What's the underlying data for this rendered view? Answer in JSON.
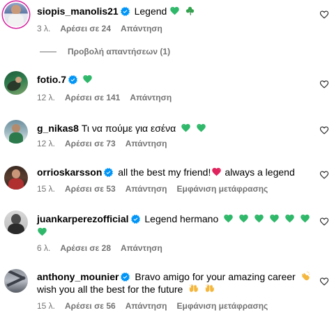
{
  "comments": [
    {
      "username": "siopis_manolis21",
      "verified": true,
      "text": "Legend",
      "time": "3 λ.",
      "likes": "Αρέσει σε 24",
      "reply": "Απάντηση",
      "view_replies": "Προβολή απαντήσεων (1)"
    },
    {
      "username": "fotio.7",
      "verified": true,
      "text": "",
      "time": "12 λ.",
      "likes": "Αρέσει σε 141",
      "reply": "Απάντηση"
    },
    {
      "username": "g_nikas8",
      "verified": false,
      "text": "Τι να πούμε για εσένα",
      "time": "12 λ.",
      "likes": "Αρέσει σε 73",
      "reply": "Απάντηση"
    },
    {
      "username": "orrioskarsson",
      "verified": true,
      "text": "all the best my friend!",
      "text2": "always a legend",
      "time": "15 λ.",
      "likes": "Αρέσει σε 53",
      "reply": "Απάντηση",
      "translate": "Εμφάνιση μετάφρασης"
    },
    {
      "username": "juankarperezofficial",
      "verified": true,
      "text": "Legend hermano",
      "time": "6 λ.",
      "likes": "Αρέσει σε 28",
      "reply": "Απάντηση"
    },
    {
      "username": "anthony_mounier",
      "verified": true,
      "text": "Bravo amigo for your amazing career",
      "text_line2": "wish you all the best for the future",
      "time": "15 λ.",
      "likes": "Αρέσει σε 56",
      "reply": "Απάντηση",
      "translate": "Εμφάνιση μετάφρασης"
    }
  ],
  "colors": {
    "meta": "#737373",
    "verified": "#0095f6",
    "green_heart": "#2fb86a",
    "red_heart": "#e0245e"
  },
  "icons": [
    "heart-outline-icon",
    "verified-badge-icon",
    "green-heart-emoji",
    "shamrock-emoji",
    "red-heart-emoji",
    "clapping-hands-emoji",
    "raising-hands-emoji"
  ]
}
